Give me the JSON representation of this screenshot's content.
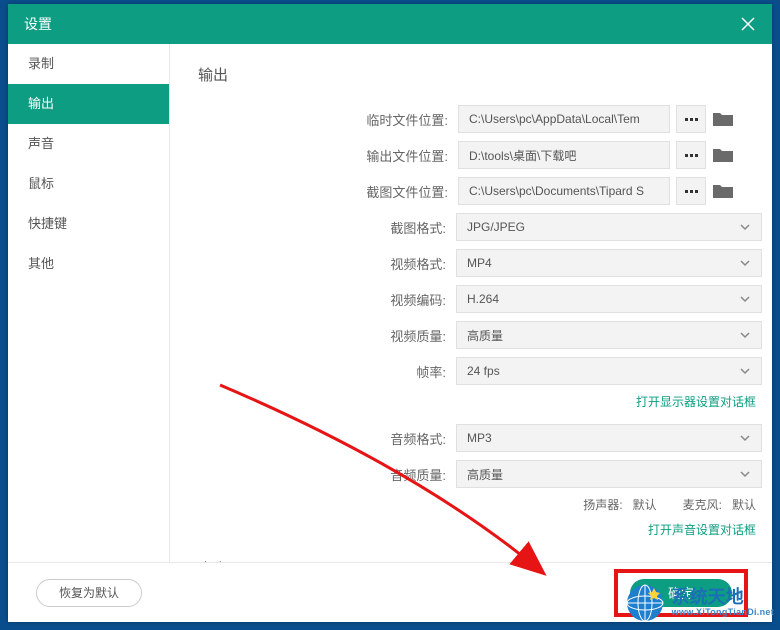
{
  "window": {
    "title": "设置"
  },
  "sidebar": {
    "items": [
      {
        "label": "录制"
      },
      {
        "label": "输出"
      },
      {
        "label": "声音"
      },
      {
        "label": "鼠标"
      },
      {
        "label": "快捷键"
      },
      {
        "label": "其他"
      }
    ],
    "activeIndex": 1
  },
  "output": {
    "section_title": "输出",
    "temp_label": "临时文件位置",
    "temp_value": "C:\\Users\\pc\\AppData\\Local\\Tem",
    "out_label": "输出文件位置",
    "out_value": "D:\\tools\\桌面\\下载吧",
    "screenshot_label": "截图文件位置",
    "screenshot_value": "C:\\Users\\pc\\Documents\\Tipard S",
    "screenshot_fmt_label": "截图格式",
    "screenshot_fmt_value": "JPG/JPEG",
    "video_fmt_label": "视频格式",
    "video_fmt_value": "MP4",
    "video_codec_label": "视频编码",
    "video_codec_value": "H.264",
    "video_quality_label": "视频质量",
    "video_quality_value": "高质量",
    "fps_label": "帧率",
    "fps_value": "24 fps",
    "display_link": "打开显示器设置对话框",
    "audio_fmt_label": "音频格式",
    "audio_fmt_value": "MP3",
    "audio_quality_label": "音频质量",
    "audio_quality_value": "高质量",
    "speaker_label": "扬声器",
    "speaker_value": "默认",
    "mic_label": "麦克风",
    "mic_value": "默认",
    "sound_link": "打开声音设置对话框",
    "sound_section": "声音"
  },
  "footer": {
    "reset_label": "恢复为默认",
    "ok_label": "确定"
  },
  "watermark": {
    "brand": "系统天地",
    "url": "www.XiTongTianDi.net"
  },
  "colors": {
    "accent": "#0d9d82",
    "annotation": "#e61414"
  }
}
